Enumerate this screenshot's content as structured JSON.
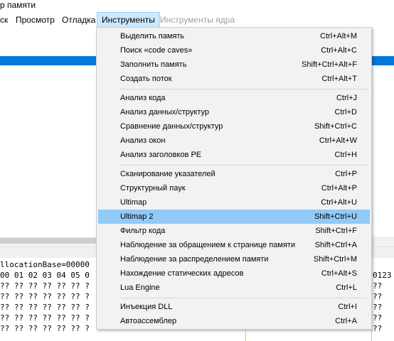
{
  "window": {
    "title": "р памяти"
  },
  "menubar": {
    "items": [
      {
        "label": "ск"
      },
      {
        "label": "Просмотр"
      },
      {
        "label": "Отладка"
      },
      {
        "label": "Инструменты"
      },
      {
        "label": "Инструменты ядра"
      }
    ]
  },
  "hex": {
    "lines": [
      "llocationBase=00000",
      "00 01 02 03 04 05 0",
      "?? ?? ?? ?? ?? ?? ?",
      "?? ?? ?? ?? ?? ?? ?",
      "?? ?? ?? ?? ?? ?? ?",
      "?? ?? ?? ?? ?? ?? ?",
      "?? ?? ?? ?? ?? ?? ?"
    ],
    "tail": [
      "",
      "0123",
      "??",
      "??",
      "??",
      "??",
      "??"
    ]
  },
  "tools_menu": {
    "groups": [
      [
        {
          "label": "Выделить память",
          "shortcut": "Ctrl+Alt+M"
        },
        {
          "label": "Поиск «code caves»",
          "shortcut": "Ctrl+Alt+C"
        },
        {
          "label": "Заполнить память",
          "shortcut": "Shift+Ctrl+Alt+F"
        },
        {
          "label": "Создать поток",
          "shortcut": "Ctrl+Alt+T"
        }
      ],
      [
        {
          "label": "Анализ кода",
          "shortcut": "Ctrl+J"
        },
        {
          "label": "Анализ данных/структур",
          "shortcut": "Ctrl+D"
        },
        {
          "label": "Сравнение данных/структур",
          "shortcut": "Shift+Ctrl+C"
        },
        {
          "label": "Анализ окон",
          "shortcut": "Ctrl+Alt+W"
        },
        {
          "label": "Анализ заголовков PE",
          "shortcut": "Ctrl+H"
        }
      ],
      [
        {
          "label": "Сканирование указателей",
          "shortcut": "Ctrl+P"
        },
        {
          "label": "Структурный паук",
          "shortcut": "Ctrl+Alt+P"
        },
        {
          "label": "Ultimap",
          "shortcut": "Ctrl+Alt+U"
        },
        {
          "label": "Ultimap 2",
          "shortcut": "Shift+Ctrl+U",
          "highlighted": true
        },
        {
          "label": "Фильтр кода",
          "shortcut": "Shift+Ctrl+F"
        },
        {
          "label": "Наблюдение за обращением к странице памяти",
          "shortcut": "Shift+Ctrl+A"
        },
        {
          "label": "Наблюдение за распределением памяти",
          "shortcut": "Shift+Ctrl+M"
        },
        {
          "label": "Нахождение статических адресов",
          "shortcut": "Ctrl+Alt+S"
        },
        {
          "label": "Lua Engine",
          "shortcut": "Ctrl+L"
        }
      ],
      [
        {
          "label": "Инъекция DLL",
          "shortcut": "Ctrl+I"
        },
        {
          "label": "Автоассемблер",
          "shortcut": "Ctrl+A"
        }
      ]
    ]
  },
  "colors": {
    "highlight": "#91c9f7",
    "selection": "#0078d7",
    "menu_bg": "#f2f2f2"
  }
}
